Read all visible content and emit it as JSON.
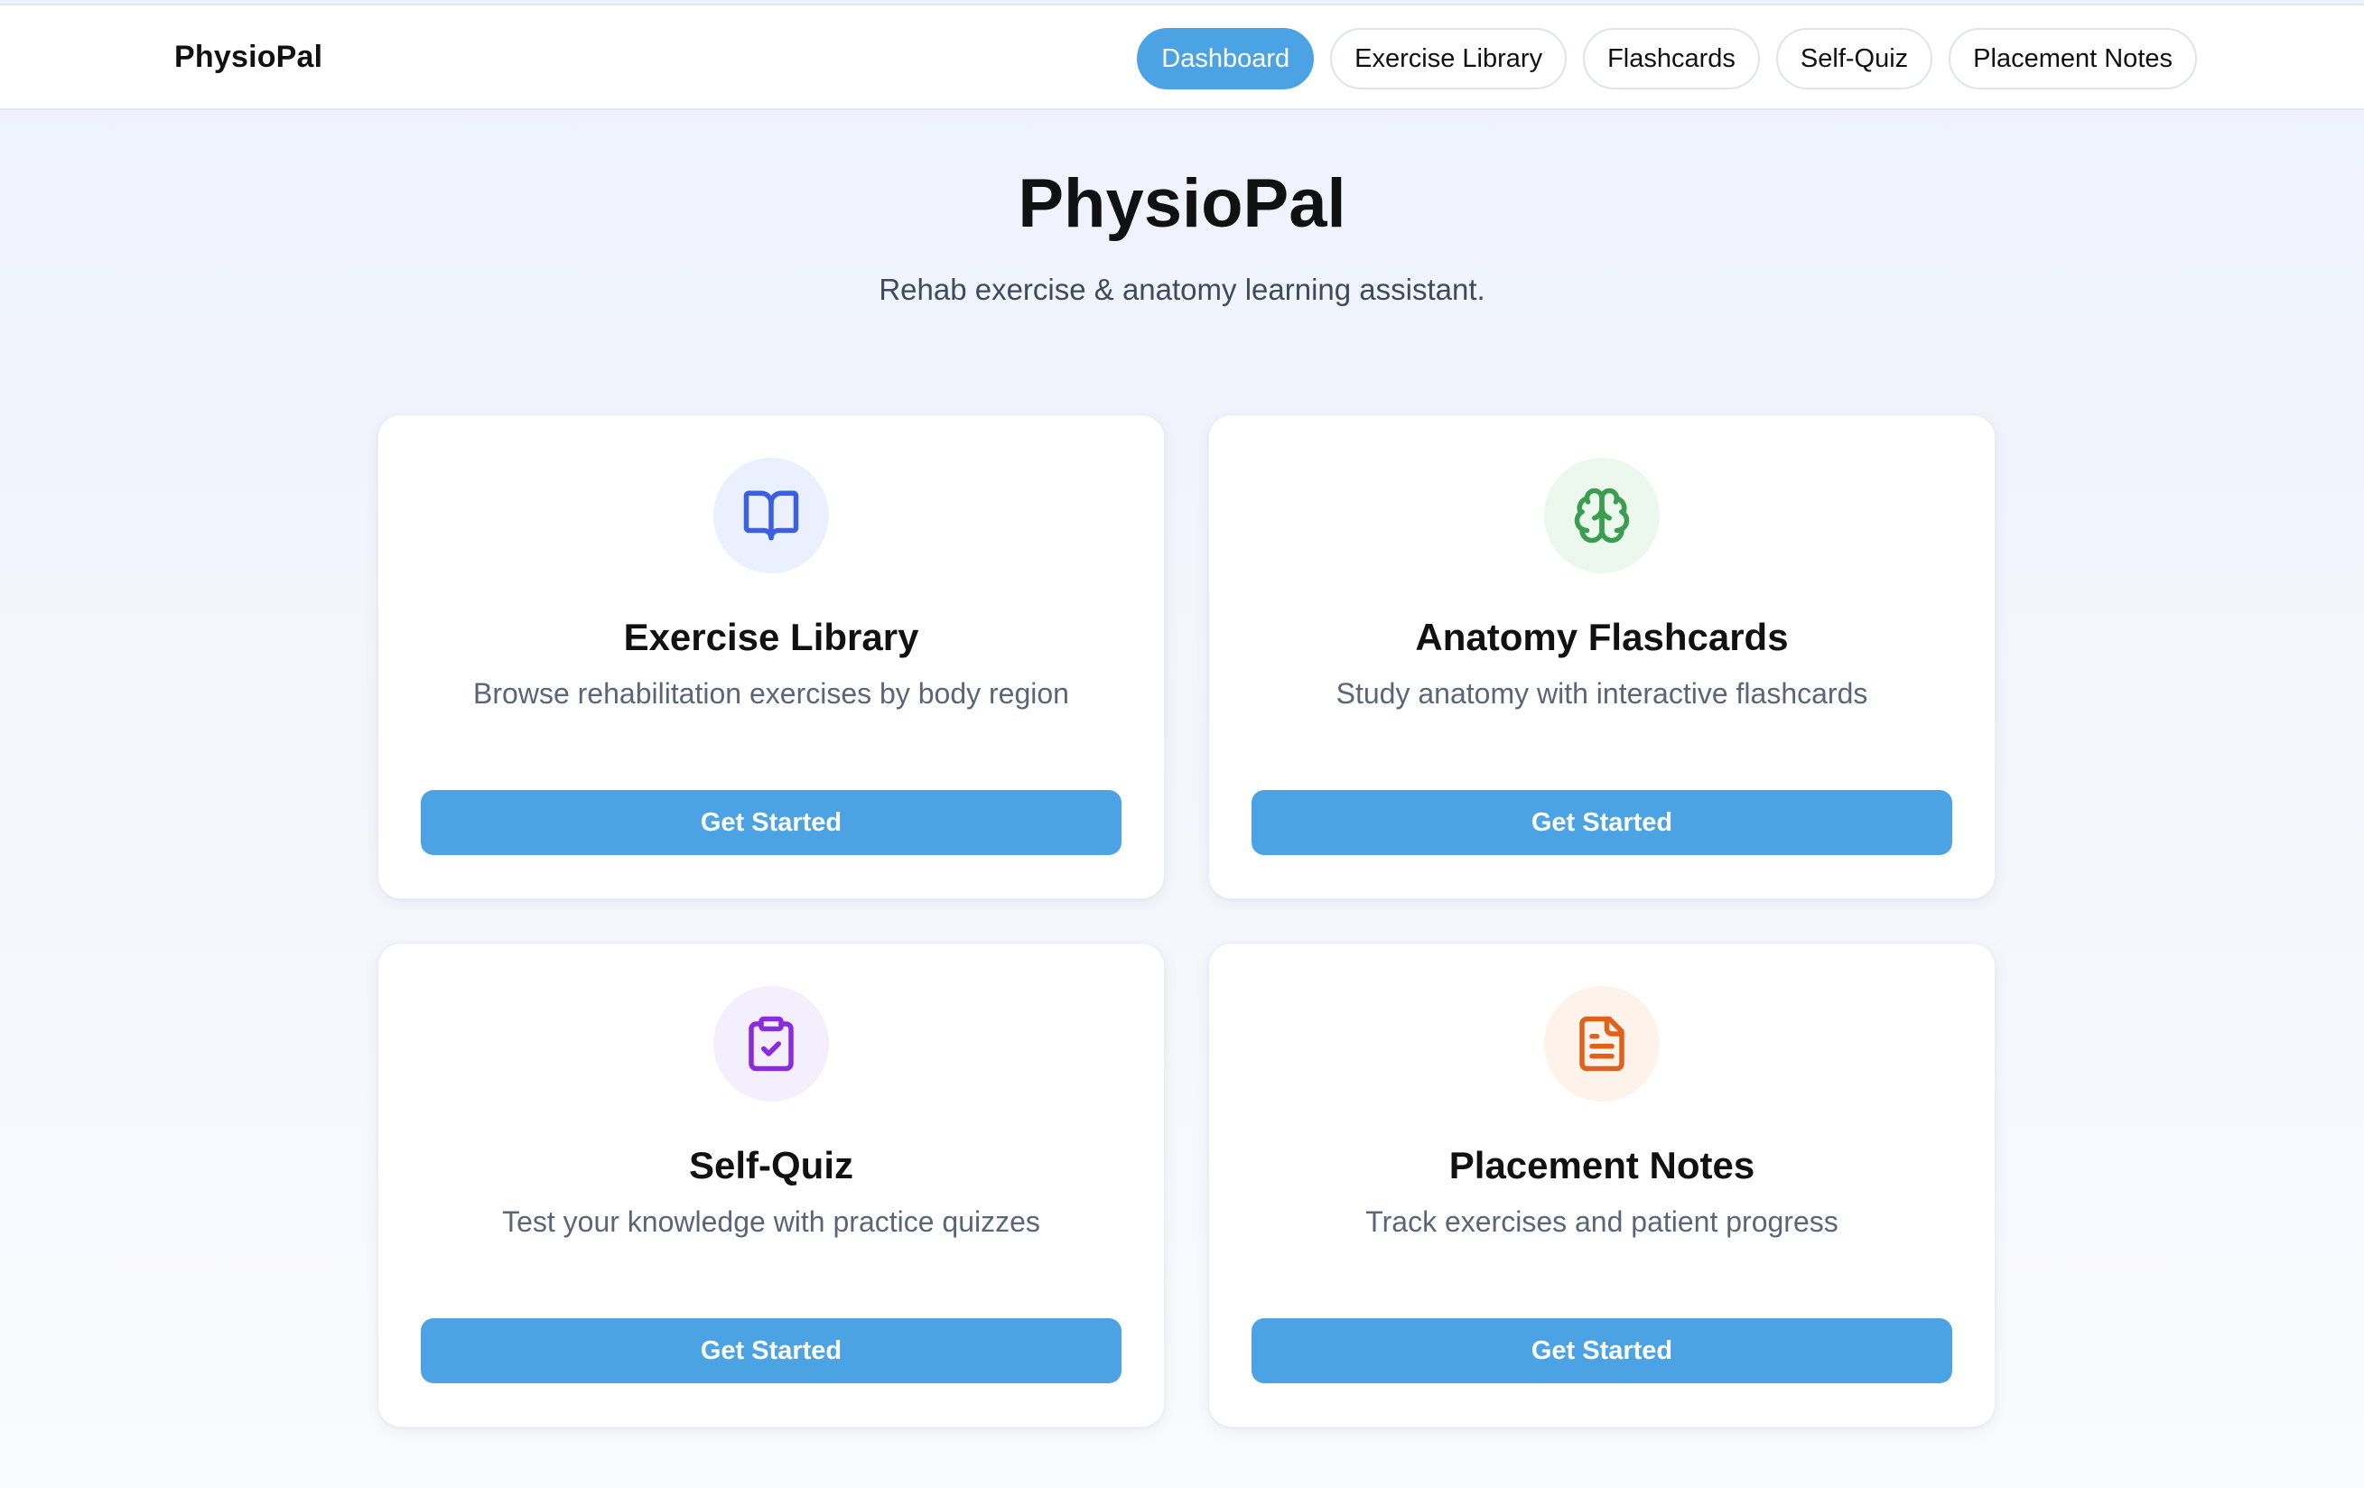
{
  "header": {
    "brand": "PhysioPal",
    "nav": [
      {
        "label": "Dashboard",
        "active": true
      },
      {
        "label": "Exercise Library",
        "active": false
      },
      {
        "label": "Flashcards",
        "active": false
      },
      {
        "label": "Self-Quiz",
        "active": false
      },
      {
        "label": "Placement Notes",
        "active": false
      }
    ]
  },
  "hero": {
    "title": "PhysioPal",
    "subtitle": "Rehab exercise & anatomy learning assistant."
  },
  "cards": [
    {
      "icon": "book-open-icon",
      "icon_color": "#3b5fe0",
      "icon_bg": "#eaf0fd",
      "title": "Exercise Library",
      "description": "Browse rehabilitation exercises by body region",
      "button": "Get Started"
    },
    {
      "icon": "brain-icon",
      "icon_color": "#3a9d4f",
      "icon_bg": "#ecf8ee",
      "title": "Anatomy Flashcards",
      "description": "Study anatomy with interactive flashcards",
      "button": "Get Started"
    },
    {
      "icon": "clipboard-check-icon",
      "icon_color": "#8b2be0",
      "icon_bg": "#f4effd",
      "title": "Self-Quiz",
      "description": "Test your knowledge with practice quizzes",
      "button": "Get Started"
    },
    {
      "icon": "file-text-icon",
      "icon_color": "#e0611b",
      "icon_bg": "#fdf3ea",
      "title": "Placement Notes",
      "description": "Track exercises and patient progress",
      "button": "Get Started"
    }
  ],
  "theme": {
    "accent": "#4ca3e3"
  }
}
